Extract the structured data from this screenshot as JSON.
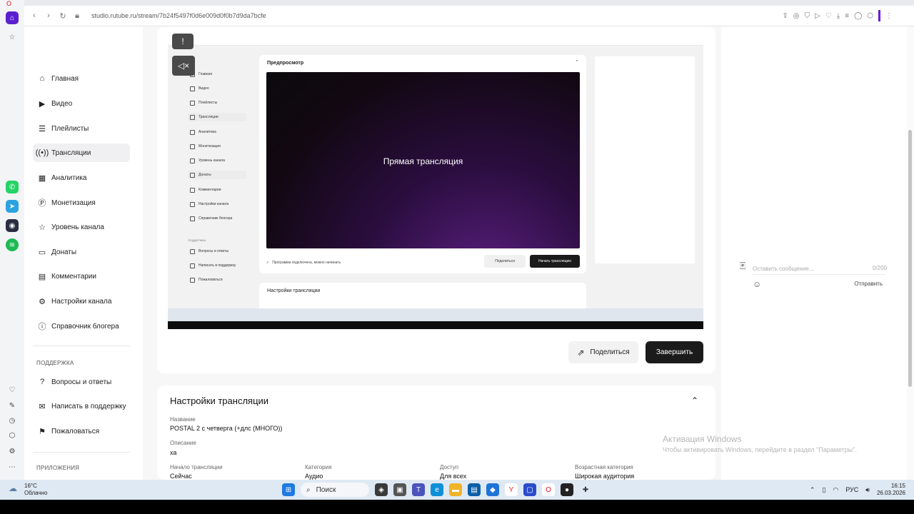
{
  "browser": {
    "url": "studio.rutube.ru/stream/7b24f5497f0d6e009d0f0b7d9da7bcfe"
  },
  "sidebar": {
    "items": [
      {
        "label": "Главная",
        "icon": "home-icon"
      },
      {
        "label": "Видео",
        "icon": "video-icon"
      },
      {
        "label": "Плейлисты",
        "icon": "playlist-icon"
      },
      {
        "label": "Трансляции",
        "icon": "broadcast-icon"
      },
      {
        "label": "Аналитика",
        "icon": "analytics-icon"
      },
      {
        "label": "Монетизация",
        "icon": "monetization-icon"
      },
      {
        "label": "Уровень канала",
        "icon": "star-icon"
      },
      {
        "label": "Донаты",
        "icon": "donate-icon"
      },
      {
        "label": "Комментарии",
        "icon": "comment-icon"
      },
      {
        "label": "Настройки канала",
        "icon": "gear-icon"
      },
      {
        "label": "Справочник блогера",
        "icon": "info-icon"
      }
    ],
    "support_label": "ПОДДЕРЖКА",
    "support_items": [
      {
        "label": "Вопросы и ответы",
        "icon": "question-icon"
      },
      {
        "label": "Написать в поддержку",
        "icon": "mail-icon"
      },
      {
        "label": "Пожаловаться",
        "icon": "flag-icon"
      }
    ],
    "apps_label": "ПРИЛОЖЕНИЯ"
  },
  "player": {
    "inner": {
      "preview_title": "Предпросмотр",
      "stream_text": "Прямая трансляция",
      "ready_text": "Программа подключена, можно начинать",
      "share": "Поделиться",
      "start": "Начать трансляцию",
      "settings_title": "Настройки трансляции",
      "nav": [
        "Главная",
        "Видео",
        "Плейлисты",
        "Трансляции",
        "Аналитика",
        "Монетизация",
        "Уровень канала",
        "Донаты",
        "Комментарии",
        "Настройки канала",
        "Справочник блогера"
      ],
      "support": [
        "ПОДДЕРЖКА",
        "Вопросы и ответы",
        "Написать в поддержку",
        "Пожаловаться"
      ]
    },
    "share_label": "Поделиться",
    "finish_label": "Завершить"
  },
  "settings": {
    "title": "Настройки трансляции",
    "name_label": "Название",
    "name_value": "POSTAL 2 с четверга (+длс (МНОГО))",
    "description_label": "Описание",
    "description_value": "ха",
    "start_label": "Начало трансляции",
    "start_value": "Сейчас",
    "category_label": "Категория",
    "category_value": "Аудио",
    "access_label": "Доступ",
    "access_value": "Для всех",
    "age_label": "Возрастная категория",
    "age_value": "Широкая аудитория"
  },
  "chat": {
    "placeholder": "Оставить сообщение...",
    "counter": "0/200",
    "send_label": "Отправить"
  },
  "activation": {
    "title": "Активация Windows",
    "subtitle": "Чтобы активировать Windows, перейдите в раздел \"Параметры\"."
  },
  "taskbar": {
    "temperature": "16°C",
    "weather": "Облачно",
    "search": "Поиск",
    "lang": "РУС",
    "time": "16:15",
    "date": "26.03.2026"
  },
  "colors": {
    "accent": "#6a1bd6",
    "dark_button": "#1b1b1b",
    "stream_gradient": "#5a1f80"
  }
}
